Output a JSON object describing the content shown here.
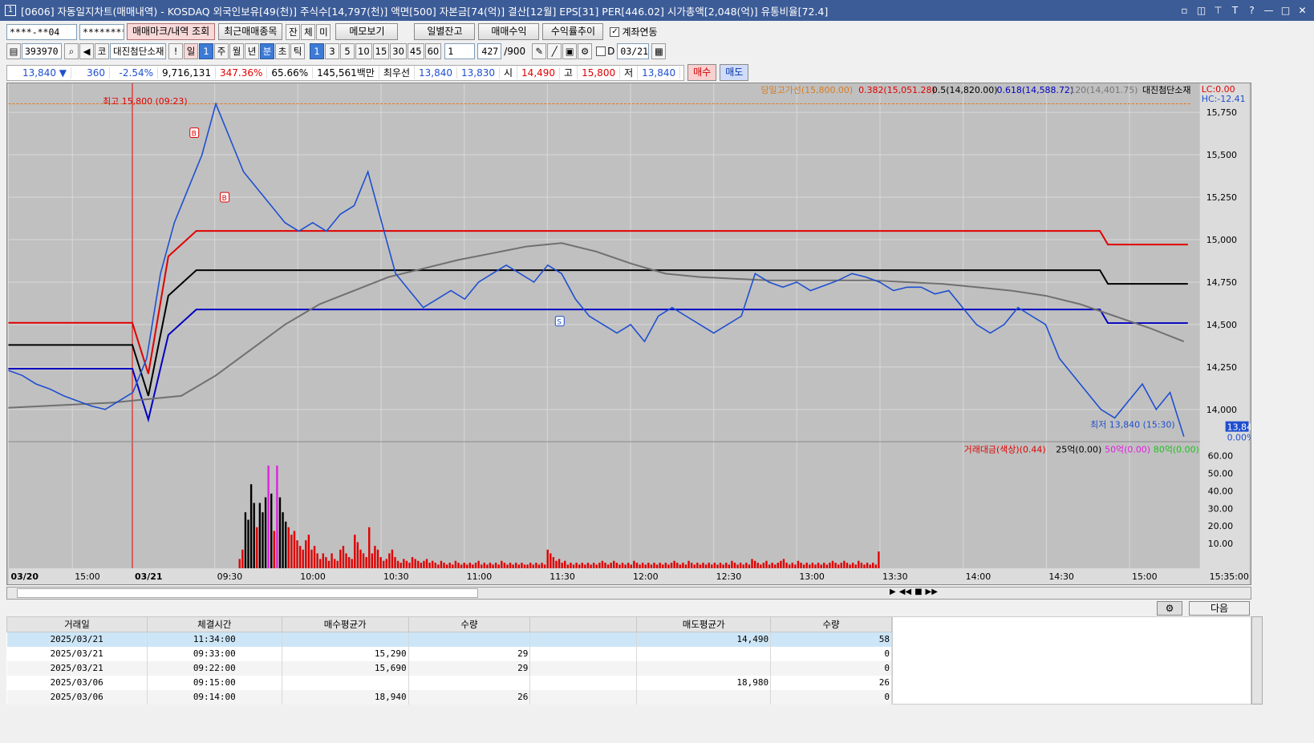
{
  "window": {
    "title": "[0606] 자동일지차트(매매내역) - KOSDAQ 외국인보유[49(천)] 주식수[14,797(천)] 액면[500] 자본금[74(억)] 결산[12월] EPS[31] PER[446.02] 시가총액[2,048(억)] 유통비율[72.4]",
    "app_icon": "1",
    "buttons": [
      "▫",
      "◫",
      "⊤",
      "T",
      "?",
      "—",
      "□",
      "✕"
    ]
  },
  "toolbar1": {
    "account": "****-**04",
    "password": "********",
    "buttons": [
      "매매마크/내역 조회",
      "최근매매종목",
      "잔",
      "체",
      "미",
      "메모보기",
      "일별잔고",
      "매매수익",
      "수익률추이"
    ],
    "checkbox_label": "계좌연동",
    "checkbox_checked": "✓"
  },
  "toolbar2": {
    "code": "393970",
    "stock_name": "대진첨단소재",
    "prefix": "코",
    "period_buttons": [
      "!",
      "일",
      "1",
      "주",
      "월",
      "년",
      "분",
      "초",
      "틱"
    ],
    "minute_buttons": [
      "1",
      "3",
      "5",
      "10",
      "15",
      "30",
      "45",
      "60"
    ],
    "interval_value": "1",
    "count_value": "427",
    "count_total": "/900",
    "checkbox_label": "D",
    "date_value": "03/21"
  },
  "quote": {
    "price": "13,840 ▼",
    "change": "360",
    "change_pct": "-2.54%",
    "volume": "9,716,131",
    "volume_pct": "347.36%",
    "ratio": "65.66%",
    "amount": "145,561백만",
    "best_label": "최우선",
    "ask": "13,840",
    "bid": "13,830",
    "open_label": "시",
    "open": "14,490",
    "high_label": "고",
    "high": "15,800",
    "low_label": "저",
    "low": "13,840",
    "buy_button": "매수",
    "sell_button": "매도"
  },
  "chart_labels": {
    "legend_prefix": "당일고가선(15,800.00)",
    "legend_382": "0.382(15,051.28)",
    "legend_5": "0.5(14,820.00)",
    "legend_618": "0.618(14,588.72)",
    "legend_120": "120(14,401.75)",
    "legend_name": "대진첨단소재",
    "lc": "LC:0.00",
    "hc": "HC:-12.41",
    "high_marker": "최고 15,800 (09:23)",
    "low_marker": "최저 13,840 (15:30)",
    "last_price": "13,840",
    "last_pct": "0.00%",
    "vol_legend_main": "거래대금(색상)(0.44)",
    "vol_legend_25": "25억(0.00)",
    "vol_legend_50": "50억(0.00)",
    "vol_legend_80": "80억(0.00)",
    "time_end": "15:35:00"
  },
  "chart_data": {
    "type": "line",
    "price_axis": {
      "ticks": [
        15750,
        15500,
        15250,
        15000,
        14750,
        14500,
        14250,
        14000
      ]
    },
    "price_axis_labels": [
      "15,750",
      "15,500",
      "15,250",
      "15,000",
      "14,750",
      "14,500",
      "14,250",
      "14,000"
    ],
    "volume_axis_labels": [
      "60.00",
      "50.00",
      "40.00",
      "30.00",
      "20.00",
      "10.00"
    ],
    "x_labels": [
      "03/20",
      "15:00",
      "03/21",
      "09:30",
      "10:00",
      "10:30",
      "11:00",
      "11:30",
      "12:00",
      "12:30",
      "13:00",
      "13:30",
      "14:00",
      "14:30",
      "15:00"
    ],
    "price_path": [
      14230,
      14200,
      14150,
      14120,
      14080,
      14050,
      14020,
      14000,
      14050,
      14100,
      14300,
      14800,
      15100,
      15300,
      15500,
      15800,
      15600,
      15400,
      15300,
      15200,
      15100,
      15050,
      15100,
      15050,
      15150,
      15200,
      15400,
      15100,
      14800,
      14700,
      14600,
      14650,
      14700,
      14650,
      14750,
      14800,
      14850,
      14800,
      14750,
      14850,
      14800,
      14650,
      14550,
      14500,
      14450,
      14500,
      14400,
      14550,
      14600,
      14550,
      14500,
      14450,
      14500,
      14550,
      14800,
      14750,
      14720,
      14750,
      14700,
      14730,
      14760,
      14800,
      14780,
      14750,
      14700,
      14720,
      14720,
      14680,
      14700,
      14600,
      14500,
      14450,
      14500,
      14600,
      14550,
      14500,
      14300,
      14200,
      14100,
      14000,
      13950,
      14050,
      14150,
      14000,
      14100,
      13840
    ],
    "sma120_path": [
      14010,
      14020,
      14030,
      14040,
      14060,
      14080,
      14200,
      14350,
      14500,
      14620,
      14700,
      14780,
      14830,
      14880,
      14920,
      14960,
      14980,
      14930,
      14860,
      14800,
      14780,
      14770,
      14760,
      14760,
      14760,
      14760,
      14750,
      14740,
      14720,
      14700,
      14670,
      14620,
      14550,
      14480,
      14400
    ],
    "buy_avg_line": [
      14780,
      14780
    ],
    "fib_382": 15051.28,
    "fib_5": 14820,
    "fib_618": 14588.72,
    "high_line": 15800,
    "markers": [
      {
        "label": "B",
        "price": 15630
      },
      {
        "label": "B",
        "price": 15250
      },
      {
        "label": "S",
        "price": 14520
      }
    ],
    "volume_bars": [
      0,
      0,
      0,
      0,
      0,
      0,
      0,
      0,
      0,
      0,
      0,
      0,
      0,
      0,
      0,
      0,
      0,
      0,
      0,
      0,
      0,
      0,
      0,
      0,
      0,
      0,
      0,
      0,
      0,
      0,
      0,
      0,
      0,
      0,
      0,
      0,
      0,
      0,
      0,
      0,
      0,
      0,
      0,
      0,
      0,
      0,
      0,
      0,
      0,
      0,
      0,
      0,
      0,
      0,
      0,
      0,
      0,
      0,
      0,
      0,
      0,
      0,
      0,
      0,
      0,
      0,
      0,
      0,
      0,
      0,
      0,
      0,
      0,
      0,
      0,
      0,
      0,
      0,
      0,
      0,
      5,
      10,
      30,
      26,
      45,
      35,
      22,
      35,
      30,
      38,
      55,
      40,
      20,
      55,
      38,
      30,
      25,
      22,
      18,
      20,
      15,
      12,
      10,
      15,
      18,
      10,
      12,
      8,
      5,
      8,
      6,
      4,
      8,
      5,
      4,
      10,
      12,
      8,
      6,
      5,
      18,
      14,
      10,
      8,
      6,
      22,
      8,
      12,
      10,
      6,
      4,
      5,
      8,
      10,
      6,
      4,
      3,
      5,
      4,
      3,
      6,
      5,
      4,
      3,
      4,
      5,
      3,
      4,
      3,
      2,
      4,
      3,
      2,
      3,
      2,
      4,
      3,
      2,
      3,
      2,
      3,
      2,
      3,
      4,
      2,
      3,
      2,
      3,
      2,
      3,
      2,
      4,
      3,
      2,
      3,
      2,
      3,
      2,
      3,
      2,
      2,
      3,
      2,
      3,
      2,
      3,
      2,
      10,
      8,
      6,
      4,
      5,
      3,
      4,
      2,
      3,
      2,
      3,
      2,
      3,
      2,
      3,
      2,
      3,
      2,
      3,
      4,
      3,
      2,
      3,
      4,
      3,
      2,
      3,
      2,
      3,
      2,
      4,
      3,
      2,
      3,
      2,
      3,
      2,
      3,
      2,
      3,
      2,
      3,
      2,
      3,
      4,
      3,
      2,
      3,
      2,
      4,
      3,
      2,
      3,
      2,
      3,
      2,
      3,
      2,
      3,
      2,
      3,
      2,
      3,
      2,
      4,
      3,
      2,
      3,
      2,
      3,
      2,
      5,
      4,
      3,
      2,
      3,
      4,
      2,
      3,
      2,
      3,
      4,
      5,
      3,
      2,
      3,
      2,
      4,
      3,
      2,
      3,
      2,
      3,
      2,
      3,
      2,
      3,
      2,
      3,
      4,
      3,
      2,
      3,
      4,
      3,
      2,
      3,
      2,
      4,
      3,
      2,
      3,
      2,
      3,
      2,
      9
    ]
  },
  "table": {
    "headers": [
      "거래일",
      "체결시간",
      "매수평균가",
      "수량",
      "",
      "매도평균가",
      "수량"
    ],
    "rows": [
      [
        "2025/03/21",
        "11:34:00",
        "",
        "",
        "",
        "14,490",
        "58"
      ],
      [
        "2025/03/21",
        "09:33:00",
        "15,290",
        "29",
        "",
        "",
        "0"
      ],
      [
        "2025/03/21",
        "09:22:00",
        "15,690",
        "29",
        "",
        "",
        "0"
      ],
      [
        "2025/03/06",
        "09:15:00",
        "",
        "",
        "",
        "18,980",
        "26"
      ],
      [
        "2025/03/06",
        "09:14:00",
        "18,940",
        "26",
        "",
        "",
        "0"
      ]
    ],
    "next_button": "다음"
  },
  "colors": {
    "up": "#e00000",
    "down": "#1f4fd0",
    "chart_bg": "#c0c0c0",
    "title_bg": "#3c5c97"
  }
}
